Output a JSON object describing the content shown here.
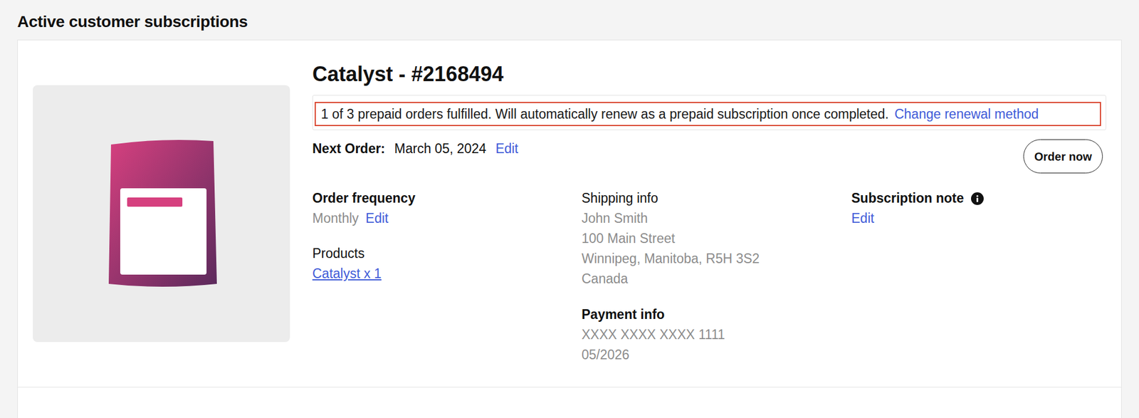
{
  "page": {
    "title": "Active customer subscriptions"
  },
  "subscription": {
    "title": "Catalyst - #2168494",
    "notice": {
      "text": "1 of 3 prepaid orders fulfilled. Will automatically renew as a prepaid subscription once completed.",
      "link": "Change renewal method"
    },
    "next_order": {
      "label": "Next Order:",
      "date": "March 05, 2024",
      "edit": "Edit"
    },
    "order_now": "Order now",
    "order_frequency": {
      "label": "Order frequency",
      "value": "Monthly",
      "edit": "Edit"
    },
    "products": {
      "label": "Products",
      "items": [
        "Catalyst x 1"
      ]
    },
    "shipping": {
      "label": "Shipping info",
      "lines": [
        "John Smith",
        "100 Main Street",
        "Winnipeg, Manitoba, R5H 3S2",
        "Canada"
      ]
    },
    "payment": {
      "label": "Payment info",
      "lines": [
        "XXXX XXXX XXXX 1111",
        "05/2026"
      ]
    },
    "note": {
      "label": "Subscription note",
      "edit": "Edit"
    }
  }
}
